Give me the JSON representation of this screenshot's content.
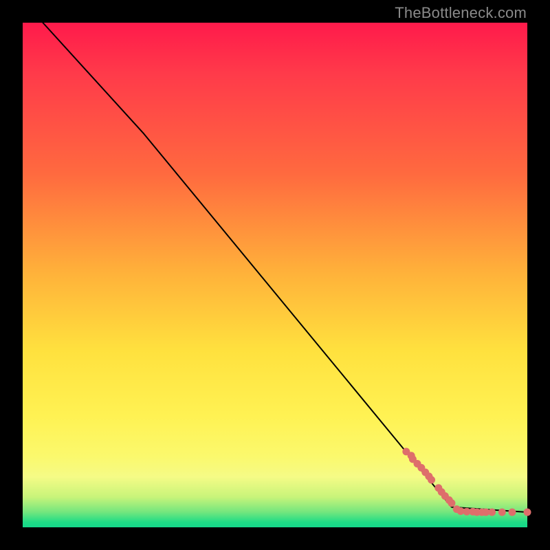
{
  "attribution": "TheBottleneck.com",
  "chart_data": {
    "type": "line",
    "title": "",
    "xlabel": "",
    "ylabel": "",
    "xlim": [
      0,
      100
    ],
    "ylim": [
      0,
      100
    ],
    "grid": false,
    "legend": false,
    "line": {
      "color": "#000000",
      "points": [
        {
          "x": 4,
          "y": 100
        },
        {
          "x": 24,
          "y": 78
        },
        {
          "x": 85,
          "y": 4
        },
        {
          "x": 100,
          "y": 3
        }
      ]
    },
    "scatter": {
      "color": "#de6e6b",
      "radius": 5.5,
      "points": [
        {
          "x": 76,
          "y": 15
        },
        {
          "x": 77,
          "y": 14.2
        },
        {
          "x": 77.3,
          "y": 13.5
        },
        {
          "x": 78.2,
          "y": 12.6
        },
        {
          "x": 79,
          "y": 11.8
        },
        {
          "x": 79.8,
          "y": 10.9
        },
        {
          "x": 80.5,
          "y": 10.1
        },
        {
          "x": 81,
          "y": 9.4
        },
        {
          "x": 82.4,
          "y": 7.8
        },
        {
          "x": 83,
          "y": 7
        },
        {
          "x": 83.7,
          "y": 6.2
        },
        {
          "x": 84.5,
          "y": 5.4
        },
        {
          "x": 85,
          "y": 4.8
        },
        {
          "x": 86,
          "y": 3.6
        },
        {
          "x": 86.8,
          "y": 3.2
        },
        {
          "x": 88,
          "y": 3.1
        },
        {
          "x": 89.2,
          "y": 3.1
        },
        {
          "x": 90,
          "y": 3
        },
        {
          "x": 91,
          "y": 3
        },
        {
          "x": 91.8,
          "y": 3
        },
        {
          "x": 93,
          "y": 3
        },
        {
          "x": 95,
          "y": 3
        },
        {
          "x": 97,
          "y": 3
        },
        {
          "x": 100,
          "y": 3
        }
      ]
    }
  }
}
